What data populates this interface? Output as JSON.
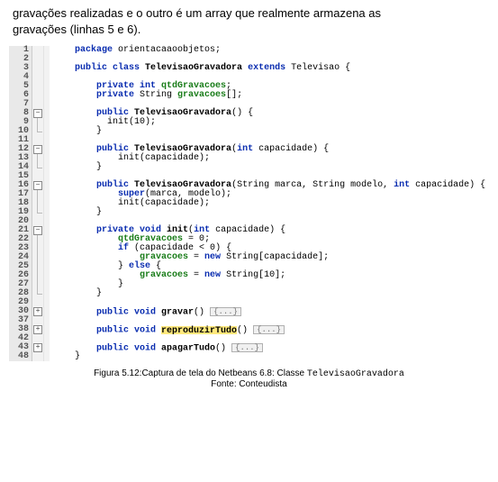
{
  "intro": {
    "line1": "gravações realizadas e o outro é um array que realmente armazena as",
    "line2": "gravações (linhas 5 e 6)."
  },
  "code": {
    "l1_kw": "package",
    "l1_rest": " orientacaaoobjetos;",
    "l3_a": "public class ",
    "l3_cls": "TelevisaoGravadora",
    "l3_b": " ",
    "l3_ext": "extends",
    "l3_c": " Televisao {",
    "l5_a": "private int ",
    "l5_fld": "qtdGravacoes",
    "l5_b": ";",
    "l6_a": "private",
    "l6_b": " String ",
    "l6_fld": "gravacoes",
    "l6_c": "[];",
    "l8_a": "public ",
    "l8_ctor": "TelevisaoGravadora",
    "l8_b": "() {",
    "l9_a": "init(",
    "l9_num": "10",
    "l9_b": ");",
    "l10_brace": "}",
    "l12_a": "public ",
    "l12_ctor": "TelevisaoGravadora",
    "l12_b": "(",
    "l12_int": "int",
    "l12_c": " capacidade) {",
    "l13": "init(capacidade);",
    "l14_brace": "}",
    "l16_a": "public ",
    "l16_ctor": "TelevisaoGravadora",
    "l16_b": "(String marca, String modelo, ",
    "l16_int": "int",
    "l16_c": " capacidade) {",
    "l17_a": "super",
    "l17_b": "(marca, modelo);",
    "l18": "init(capacidade);",
    "l19_brace": "}",
    "l21_a": "private void ",
    "l21_m": "init",
    "l21_b": "(",
    "l21_int": "int",
    "l21_c": " capacidade) {",
    "l22_fld": "qtdGravacoes",
    "l22_b": " = ",
    "l22_num": "0",
    "l22_c": ";",
    "l23_a": "if",
    "l23_b": " (capacidade < ",
    "l23_num": "0",
    "l23_c": ") {",
    "l24_fld": "gravacoes",
    "l24_b": " = ",
    "l24_new": "new",
    "l24_c": " String[capacidade];",
    "l25_a": "} ",
    "l25_else": "else",
    "l25_b": " {",
    "l26_fld": "gravacoes",
    "l26_b": " = ",
    "l26_new": "new",
    "l26_c": " String[",
    "l26_num": "10",
    "l26_d": "];",
    "l27_brace": "}",
    "l28_brace": "}",
    "l30_a": "public void ",
    "l30_m": "gravar",
    "l30_b": "() ",
    "fold_label": "{...}",
    "l38_a": "public void ",
    "l38_m": "reproduzirTudo",
    "l38_b": "() ",
    "l43_a": "public void ",
    "l43_m": "apagarTudo",
    "l43_b": "() ",
    "l48_brace": "}"
  },
  "lineNumbers": {
    "n1": "1",
    "n2": "2",
    "n3": "3",
    "n4": "4",
    "n5": "5",
    "n6": "6",
    "n7": "7",
    "n8": "8",
    "n9": "9",
    "n10": "10",
    "n11": "11",
    "n12": "12",
    "n13": "13",
    "n14": "14",
    "n15": "15",
    "n16": "16",
    "n17": "17",
    "n18": "18",
    "n19": "19",
    "n20": "20",
    "n21": "21",
    "n22": "22",
    "n23": "23",
    "n24": "24",
    "n25": "25",
    "n26": "26",
    "n27": "27",
    "n28": "28",
    "n29": "29",
    "n30": "30",
    "n37": "37",
    "n38": "38",
    "n42": "42",
    "n43": "43",
    "n48": "48"
  },
  "foldGlyph": {
    "minus": "−",
    "plus": "+"
  },
  "caption": {
    "main_a": "Figura 5.12:Captura de tela do Netbeans 6.8: Classe ",
    "main_code": "TelevisaoGravadora",
    "sub": "Fonte: Conteudista"
  }
}
